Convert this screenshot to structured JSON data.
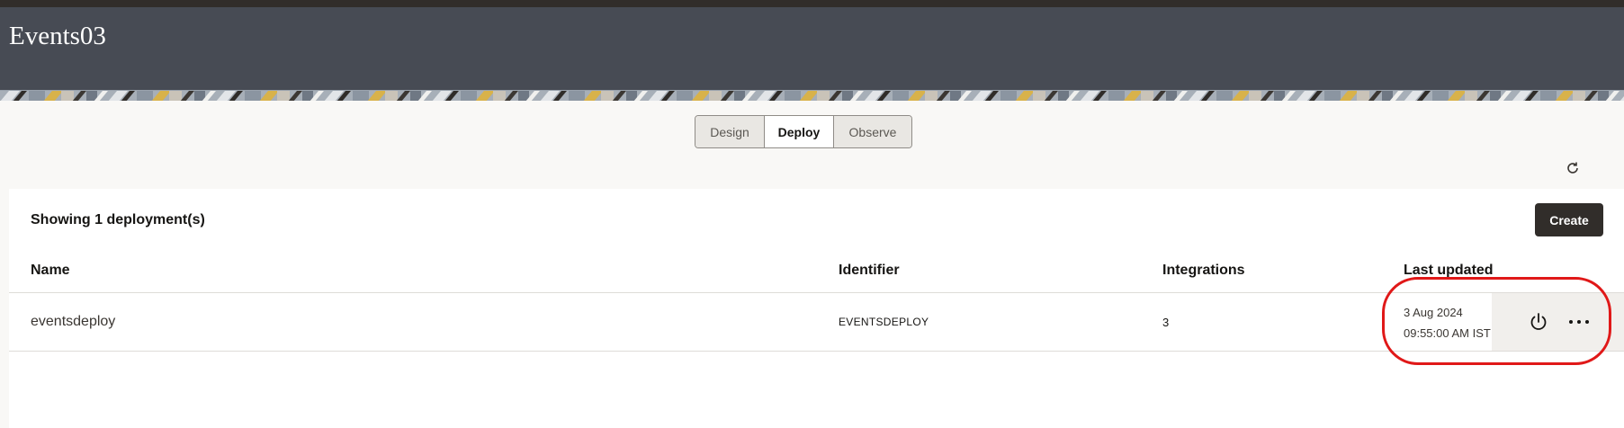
{
  "app": {
    "title": "Events03"
  },
  "tabs": [
    {
      "label": "Design",
      "active": false
    },
    {
      "label": "Deploy",
      "active": true
    },
    {
      "label": "Observe",
      "active": false
    }
  ],
  "toolbar": {
    "refresh_icon": "refresh-icon"
  },
  "panel": {
    "summary": "Showing 1 deployment(s)",
    "create_label": "Create"
  },
  "table": {
    "columns": [
      "Name",
      "Identifier",
      "Integrations",
      "Last updated"
    ],
    "rows": [
      {
        "name": "eventsdeploy",
        "identifier": "EVENTSDEPLOY",
        "integrations": "3",
        "last_updated_date": "3 Aug 2024",
        "last_updated_time": "09:55:00 AM IST",
        "actions": [
          "power-icon",
          "more-options-icon"
        ]
      }
    ]
  },
  "colors": {
    "header_bg": "#474b54",
    "create_bg": "#312d2a",
    "highlight": "#e01818"
  }
}
